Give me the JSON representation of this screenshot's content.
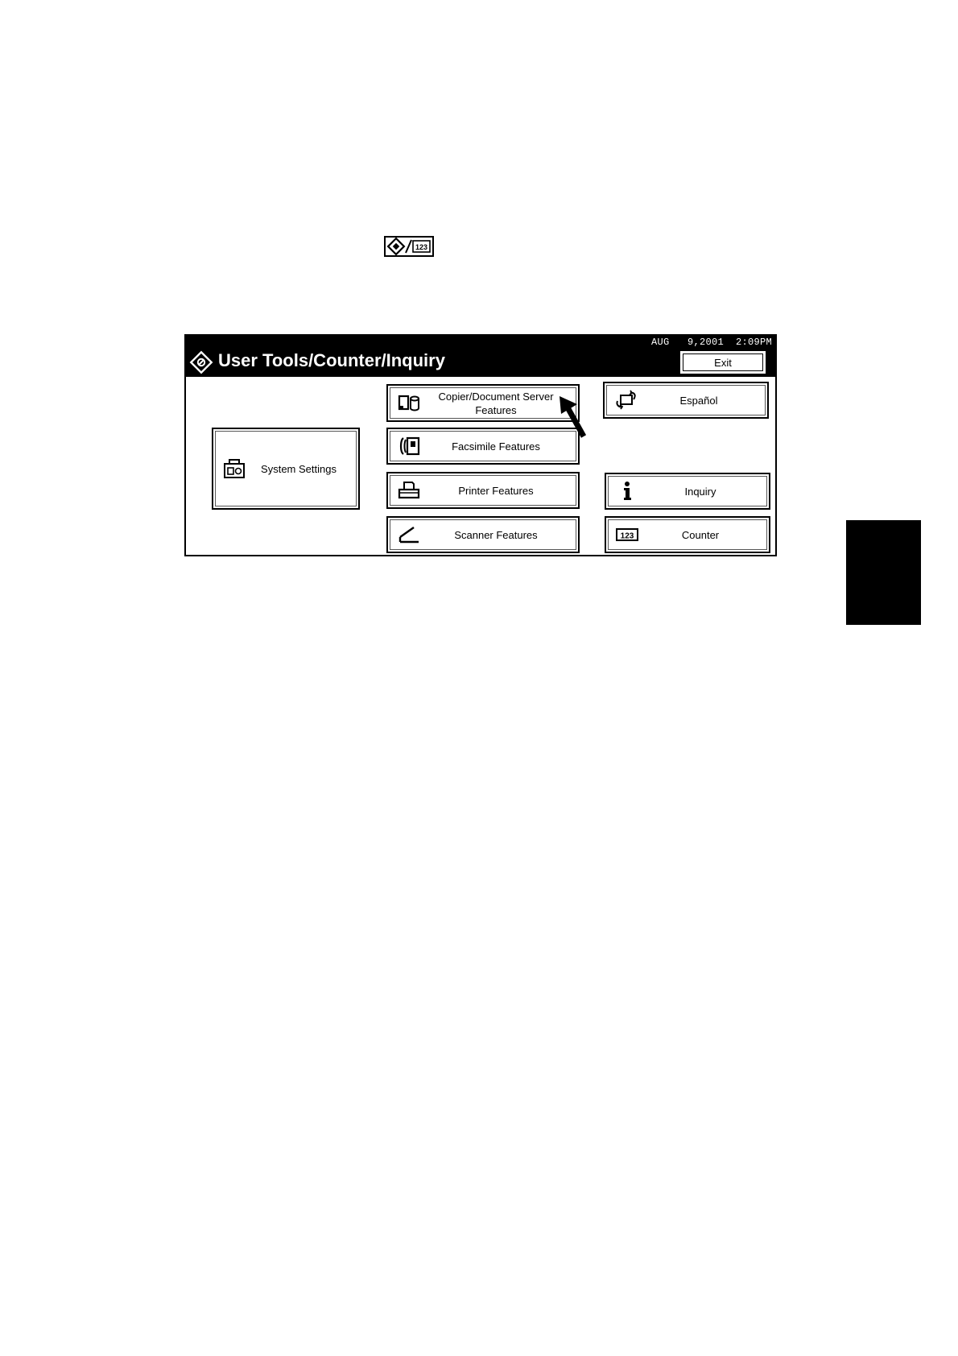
{
  "key_icon": {
    "name": "user-tools-counter-key-icon",
    "text": "123"
  },
  "panel": {
    "datetime": "AUG   9,2001  2:09PM",
    "title": "User Tools/Counter/Inquiry",
    "exit_label": "Exit"
  },
  "buttons": {
    "system_settings": {
      "label": "System Settings",
      "icon": "system-settings-icon"
    },
    "copier": {
      "label_line1": "Copier/Document Server",
      "label_line2": "Features",
      "icon": "copier-document-server-icon"
    },
    "facsimile": {
      "label": "Facsimile Features",
      "icon": "facsimile-icon"
    },
    "printer": {
      "label": "Printer Features",
      "icon": "printer-icon"
    },
    "scanner": {
      "label": "Scanner Features",
      "icon": "scanner-icon"
    },
    "espanol": {
      "label": "Español",
      "icon": "language-switch-icon"
    },
    "inquiry": {
      "label": "Inquiry",
      "icon": "info-icon"
    },
    "counter": {
      "label": "Counter",
      "icon": "counter-123-icon",
      "icon_text": "123"
    }
  },
  "colors": {
    "background": "#ffffff",
    "foreground": "#000000"
  }
}
